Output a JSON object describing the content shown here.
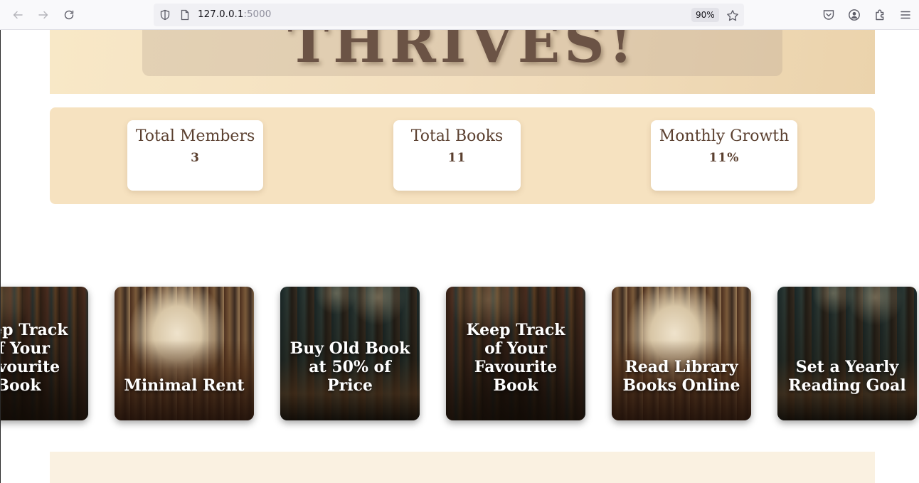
{
  "browser": {
    "url_host": "127.0.0.1",
    "url_port": ":5000",
    "zoom": "90%"
  },
  "hero": {
    "title": "THRIVES!"
  },
  "stats": [
    {
      "label": "Total Members",
      "value": "3"
    },
    {
      "label": "Total Books",
      "value": "11"
    },
    {
      "label": "Monthly Growth",
      "value": "11%"
    }
  ],
  "features": [
    {
      "text": "Keep Track of Your Favourite Book",
      "bg": "shelf"
    },
    {
      "text": "Minimal Rent",
      "bg": "open"
    },
    {
      "text": "Buy Old Book at 50% of Price",
      "bg": "dark"
    },
    {
      "text": "Keep Track of Your Favourite Book",
      "bg": "shelf"
    },
    {
      "text": "Read Library Books Online",
      "bg": "open"
    },
    {
      "text": "Set a Yearly Reading Goal",
      "bg": "dark"
    }
  ],
  "colors": {
    "hero_bg": "#f3dfbf",
    "stats_bg": "#f6e2c0",
    "text_brown": "#5b4030"
  }
}
